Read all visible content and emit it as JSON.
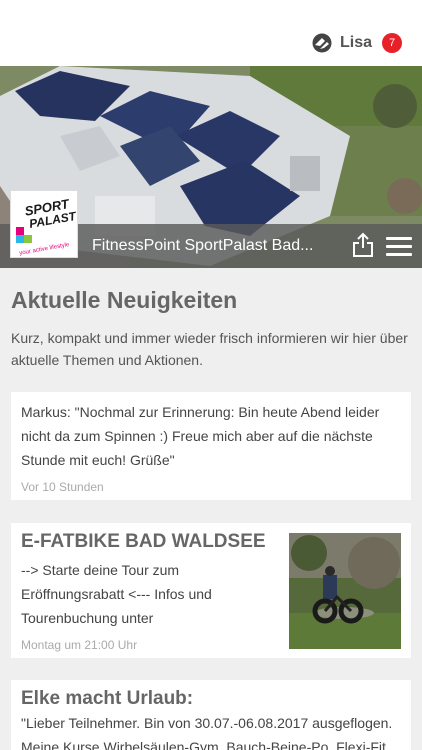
{
  "user": {
    "name": "Lisa",
    "notifications": "7"
  },
  "studio": {
    "title": "FitnessPoint SportPalast Bad...",
    "logo_line1": "SPORT",
    "logo_line2": "PALAST",
    "logo_tagline": "your active lifestyle"
  },
  "news": {
    "heading": "Aktuelle Neuigkeiten",
    "intro": "Kurz, kompakt und immer wieder frisch informieren wir hier über aktuelle Themen und Aktionen.",
    "items": [
      {
        "body": "Markus: \"Nochmal zur Erinnerung: Bin heute Abend leider nicht da zum Spinnen :) Freue mich aber auf die nächste Stunde mit euch! Grüße\"",
        "time": "Vor 10 Stunden"
      },
      {
        "title": "E-FATBIKE BAD WALDSEE",
        "body": "--> Starte deine Tour zum Eröffnungsrabatt <--- Infos und Tourenbuchung unter",
        "time": "Montag um 21:00 Uhr"
      },
      {
        "title": "Elke macht Urlaub:",
        "body_line1": "\"Lieber Teilnehmer. Bin von 30.07.-06.08.2017 ausgeflogen.",
        "body_line2": "Meine Kurse Wirbelsäulen-Gym, Bauch-Beine-Po, Flexi-Fit"
      }
    ]
  },
  "colors": {
    "badge": "#e8202a",
    "strip": "#5a5a5a",
    "background": "#efefef"
  }
}
